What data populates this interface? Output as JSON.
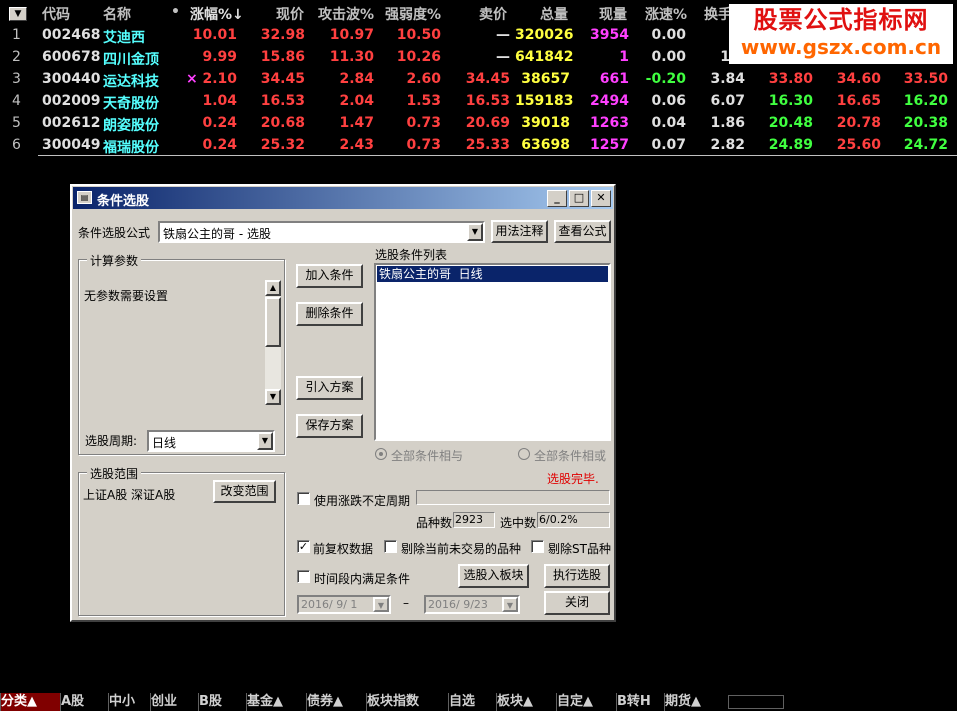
{
  "stock_table": {
    "headers": {
      "code": "代码",
      "name": "名称",
      "flag": "•",
      "change_pct": "涨幅%↓",
      "price": "现价",
      "attack_wave": "攻击波%",
      "strength": "强弱度%",
      "ask": "卖价",
      "volume": "总量",
      "current_volume": "现量",
      "speed": "涨速%",
      "turnover": "换手"
    },
    "rows": [
      {
        "n": "1",
        "code": "002468",
        "name": "艾迪西",
        "mark": "",
        "change": "10.01",
        "price": "32.98",
        "attack": "10.97",
        "strength": "10.50",
        "ask": "—",
        "volume": "320026",
        "cur": "3954",
        "speed": "0.00",
        "turnover": "9.",
        "c1": "",
        "c2": "",
        "c3": ""
      },
      {
        "n": "2",
        "code": "600678",
        "name": "四川金顶",
        "mark": "",
        "change": "9.99",
        "price": "15.86",
        "attack": "11.30",
        "strength": "10.26",
        "ask": "—",
        "volume": "641842",
        "cur": "1",
        "speed": "0.00",
        "turnover": "18.",
        "c1": "",
        "c2": "",
        "c3": ""
      },
      {
        "n": "3",
        "code": "300440",
        "name": "运达科技",
        "mark": "×",
        "change": "2.10",
        "price": "34.45",
        "attack": "2.84",
        "strength": "2.60",
        "ask": "34.45",
        "volume": "38657",
        "cur": "661",
        "speed": "-0.20",
        "turnover": "3.84",
        "c1": "33.80",
        "c2": "34.60",
        "c3": "33.50"
      },
      {
        "n": "4",
        "code": "002009",
        "name": "天奇股份",
        "mark": "",
        "change": "1.04",
        "price": "16.53",
        "attack": "2.04",
        "strength": "1.53",
        "ask": "16.53",
        "volume": "159183",
        "cur": "2494",
        "speed": "0.06",
        "turnover": "6.07",
        "c1": "16.30",
        "c2": "16.65",
        "c3": "16.20"
      },
      {
        "n": "5",
        "code": "002612",
        "name": "朗姿股份",
        "mark": "",
        "change": "0.24",
        "price": "20.68",
        "attack": "1.47",
        "strength": "0.73",
        "ask": "20.69",
        "volume": "39018",
        "cur": "1263",
        "speed": "0.04",
        "turnover": "1.86",
        "c1": "20.48",
        "c2": "20.78",
        "c3": "20.38"
      },
      {
        "n": "6",
        "code": "300049",
        "name": "福瑞股份",
        "mark": "",
        "change": "0.24",
        "price": "25.32",
        "attack": "2.43",
        "strength": "0.73",
        "ask": "25.33",
        "volume": "63698",
        "cur": "1257",
        "speed": "0.07",
        "turnover": "2.82",
        "c1": "24.89",
        "c2": "25.60",
        "c3": "24.72"
      }
    ],
    "sort_toggle": "▼"
  },
  "watermark": {
    "line1": "股票公式指标网",
    "line2": "www.gszx.com.cn"
  },
  "dialog": {
    "title": "条件选股",
    "formula_label": "条件选股公式",
    "formula_value": "铁扇公主的哥 - 选股",
    "usage_button": "用法注释",
    "view_formula_button": "查看公式",
    "calc_params_title": "计算参数",
    "calc_params_text": "无参数需要设置",
    "period_label": "选股周期:",
    "period_value": "日线",
    "range_title": "选股范围",
    "range_text": "上证A股 深证A股",
    "change_range_button": "改变范围",
    "add_condition_button": "加入条件",
    "delete_condition_button": "删除条件",
    "import_plan_button": "引入方案",
    "save_plan_button": "保存方案",
    "condition_list_label": "选股条件列表",
    "condition_items": [
      "铁扇公主的哥  日线"
    ],
    "radio_and": "全部条件相与",
    "radio_or": "全部条件相或",
    "status": "选股完毕.",
    "use_limit_period": "使用涨跌不定周期",
    "stock_count_label": "品种数",
    "stock_count_value": "2923",
    "selected_count_label": "选中数",
    "selected_count_value": "6/0.2%",
    "forward_adjust": "前复权数据",
    "exclude_untraded": "剔除当前未交易的品种",
    "exclude_st": "剔除ST品种",
    "time_period_condition": "时间段内满足条件",
    "select_to_block_button": "选股入板块",
    "execute_button": "执行选股",
    "date_from": "2016/ 9/ 1",
    "date_sep": "–",
    "date_to": "2016/ 9/23",
    "close_button": "关闭"
  },
  "bottom_tabs": [
    "分类▲",
    "A股",
    "中小",
    "创业",
    "B股",
    "基金▲",
    "债券▲",
    "板块指数",
    "自选",
    "板块▲",
    "自定▲",
    "B转H",
    "期货▲"
  ],
  "colors": {
    "up": "#ff4040",
    "down": "#40ff40",
    "name": "#55ffff",
    "titlebar": "#0a246a",
    "status": "#e00000"
  }
}
